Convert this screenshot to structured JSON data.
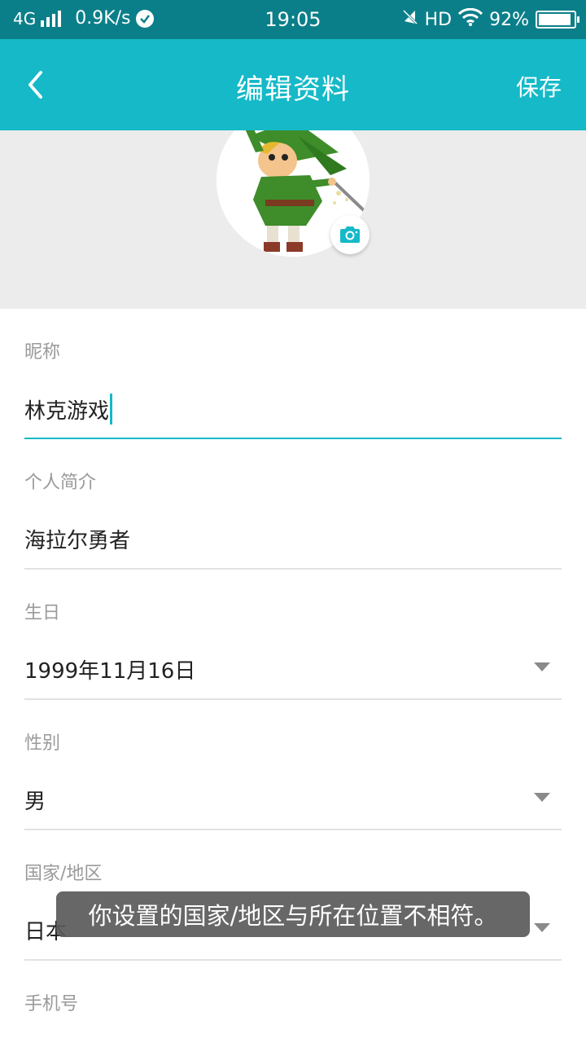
{
  "status_bar": {
    "network": "4G",
    "speed": "0.9K/s",
    "time": "19:05",
    "hd": "HD",
    "battery": "92%",
    "battery_level": 0.92
  },
  "header": {
    "title": "编辑资料",
    "save_label": "保存"
  },
  "form": {
    "nickname": {
      "label": "昵称",
      "value": "林克游戏"
    },
    "bio": {
      "label": "个人简介",
      "value": "海拉尔勇者"
    },
    "birthday": {
      "label": "生日",
      "value": "1999年11月16日"
    },
    "gender": {
      "label": "性别",
      "value": "男"
    },
    "country": {
      "label": "国家/地区",
      "value": "日本"
    },
    "phone": {
      "label": "手机号"
    }
  },
  "toast": "你设置的国家/地区与所在位置不相符。",
  "colors": {
    "accent": "#15b9c8",
    "status_bar": "#0b7f89",
    "avatar_bg": "#ececec"
  }
}
